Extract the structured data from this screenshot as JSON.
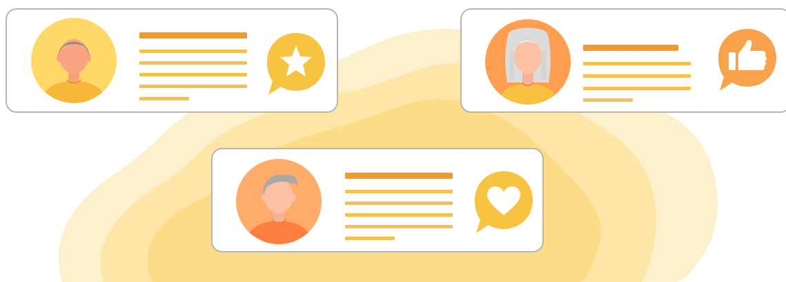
{
  "illustration": {
    "theme": "customer-reviews",
    "colors": {
      "background": "#ffffff",
      "blob_light": "#fdecc0",
      "blob_mid": "#fde3a0",
      "blob_dark": "#fcd97e",
      "card_border": "#b5b5b5",
      "line_heading": "#f39a2b",
      "line_body": "#f7c04c",
      "bubble_yellow": "#f7c340",
      "bubble_orange": "#f9a24c",
      "avatar_yellow_bg": "#ffd867",
      "avatar_orange_bg": "#ff9e50",
      "avatar_peach_bg": "#ffab6a"
    },
    "cards": [
      {
        "id": "review-1",
        "avatar": "man-grey-hair",
        "reaction_icon": "star-icon"
      },
      {
        "id": "review-2",
        "avatar": "woman-grey-hair",
        "reaction_icon": "thumbs-up-icon"
      },
      {
        "id": "review-3",
        "avatar": "man-grey-quiff",
        "reaction_icon": "heart-icon"
      }
    ]
  }
}
